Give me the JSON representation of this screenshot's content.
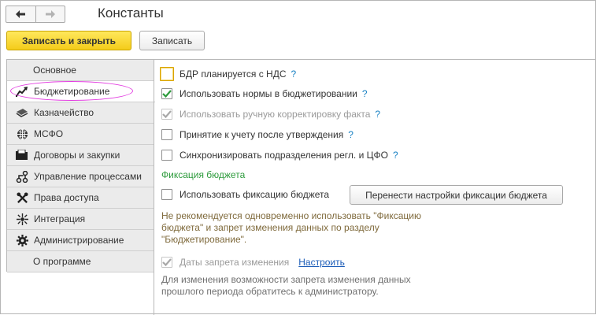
{
  "window": {
    "title": "Константы"
  },
  "nav": {
    "back_icon": "arrow-left-icon",
    "forward_icon": "arrow-right-icon"
  },
  "toolbar": {
    "save_close_label": "Записать и закрыть",
    "save_label": "Записать"
  },
  "sidebar": {
    "items": [
      {
        "label": "Основное",
        "icon": ""
      },
      {
        "label": "Бюджетирование",
        "icon": "chart-up-icon",
        "active": true
      },
      {
        "label": "Казначейство",
        "icon": "money-icon"
      },
      {
        "label": "МСФО",
        "icon": "globe-icon"
      },
      {
        "label": "Договоры и закупки",
        "icon": "folder-icon"
      },
      {
        "label": "Управление процессами",
        "icon": "workflow-icon"
      },
      {
        "label": "Права доступа",
        "icon": "tools-icon"
      },
      {
        "label": "Интеграция",
        "icon": "integration-icon"
      },
      {
        "label": "Администрирование",
        "icon": "gear-icon"
      },
      {
        "label": "О программе",
        "icon": ""
      }
    ]
  },
  "options": {
    "bdr_vat": {
      "label": "БДР планируется с НДС",
      "checked": false,
      "help": "?"
    },
    "budget_norms": {
      "label": "Использовать нормы в бюджетировании",
      "checked": true,
      "help": "?"
    },
    "manual_fact": {
      "label": "Использовать ручную корректировку факта",
      "checked": true,
      "disabled": true,
      "help": "?"
    },
    "accept_after_approval": {
      "label": "Принятие к учету после утверждения",
      "checked": false,
      "help": "?"
    },
    "sync_departments": {
      "label": "Синхронизировать подразделения регл. и ЦФО",
      "checked": false,
      "help": "?"
    }
  },
  "fixation": {
    "section_title": "Фиксация бюджета",
    "use_label": "Использовать фиксацию бюджета",
    "use_checked": false,
    "transfer_button": "Перенести настройки фиксации бюджета",
    "note": "Не рекомендуется одновременно использовать \"Фиксацию\nбюджета\" и запрет изменения данных по разделу\n\"Бюджетирование\"."
  },
  "lock_dates": {
    "label": "Даты запрета изменения",
    "checked": true,
    "disabled": true,
    "link": "Настроить",
    "note": "Для изменения возможности запрета изменения данных\nпрошлого периода обратитесь к администратору."
  },
  "colors": {
    "primary_button": "#f4cc1a",
    "section_title": "#2d9b3c",
    "help": "#1a82c4",
    "link": "#1b5cb8",
    "warning_note": "#7f6a3c",
    "highlight": "#e23be0"
  }
}
